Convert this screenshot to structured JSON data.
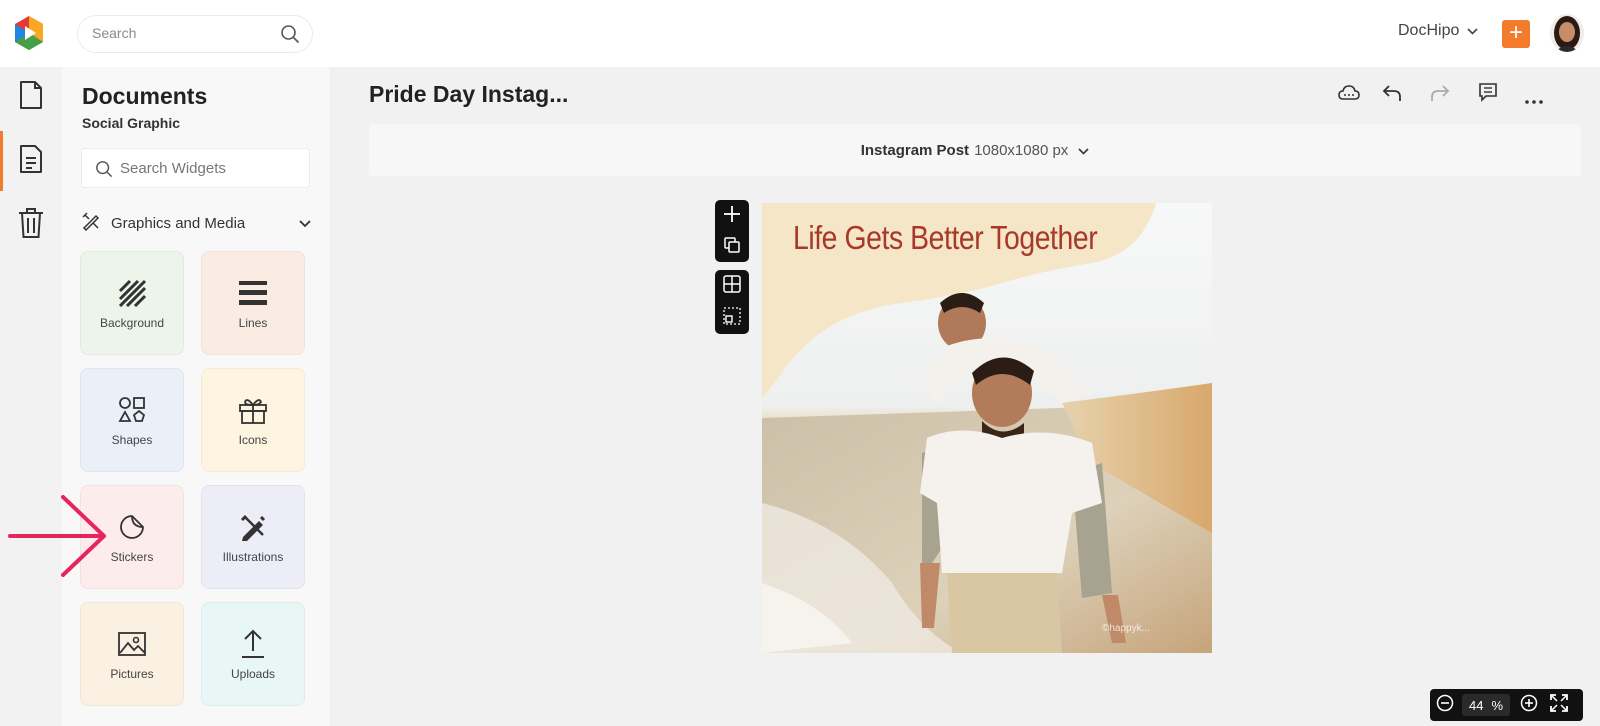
{
  "header": {
    "search_placeholder": "Search",
    "brand_menu_label": "DocHipo",
    "create_label": "+"
  },
  "rail": {
    "items": [
      {
        "icon": "new-document-icon",
        "active": false
      },
      {
        "icon": "documents-icon",
        "active": true
      },
      {
        "icon": "trash-icon",
        "active": false
      }
    ]
  },
  "panel": {
    "title": "Documents",
    "subtitle": "Social Graphic",
    "widget_search_placeholder": "Search Widgets",
    "section_label": "Graphics and Media",
    "tiles": [
      {
        "label": "Background",
        "icon": "background-icon",
        "color": "#edf5ea"
      },
      {
        "label": "Lines",
        "icon": "lines-icon",
        "color": "#faece3"
      },
      {
        "label": "Shapes",
        "icon": "shapes-icon",
        "color": "#eaf0f8"
      },
      {
        "label": "Icons",
        "icon": "gift-icon",
        "color": "#fdf5df"
      },
      {
        "label": "Stickers",
        "icon": "sticker-icon",
        "color": "#fdecec"
      },
      {
        "label": "Illustrations",
        "icon": "illustrations-icon",
        "color": "#ededf8"
      },
      {
        "label": "Pictures",
        "icon": "picture-icon",
        "color": "#fbf1e2"
      },
      {
        "label": "Uploads",
        "icon": "upload-icon",
        "color": "#e9f6f6"
      }
    ]
  },
  "document": {
    "title": "Pride Day Instag...",
    "size_name": "Instagram Post",
    "size_value": "1080x1080 px"
  },
  "canvas": {
    "headline": "Life Gets Better Together",
    "watermark": "©happyk..."
  },
  "zoom": {
    "value": "44",
    "unit": "%"
  },
  "colors": {
    "accent": "#f27b2c",
    "headline": "#a8382a",
    "arrow": "#e6245e",
    "blob": "#f6e6c8"
  }
}
